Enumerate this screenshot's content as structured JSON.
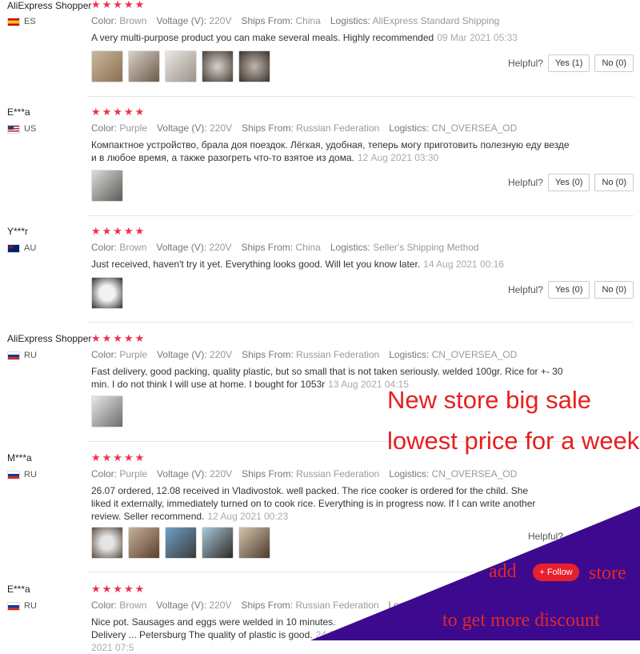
{
  "reviews": [
    {
      "user": "AliExpress Shopper",
      "country": "ES",
      "stars": "★★★★★",
      "color": "Brown",
      "voltage": "220V",
      "ships_from": "China",
      "logistics": "AliExpress Standard Shipping",
      "text": "A very multi-purpose product you can make several meals. Highly recommended",
      "date": "09 Mar 2021 05:33",
      "helpful": "Helpful?",
      "yes": "Yes (1)",
      "no": "No (0)"
    },
    {
      "user": "E***a",
      "country": "US",
      "stars": "★★★★★",
      "color": "Purple",
      "voltage": "220V",
      "ships_from": "Russian Federation",
      "logistics": "CN_OVERSEA_OD",
      "text": "Компактное устройство, брала доя поездок. Лёгкая, удобная, теперь могу приготовить полезную еду везде и в любое время, а также разогреть что-то взятое из дома.",
      "date": "12 Aug 2021 03:30",
      "helpful": "Helpful?",
      "yes": "Yes (0)",
      "no": "No (0)"
    },
    {
      "user": "Y***r",
      "country": "AU",
      "stars": "★★★★★",
      "color": "Brown",
      "voltage": "220V",
      "ships_from": "China",
      "logistics": "Seller's Shipping Method",
      "text": "Just received, haven't try it yet. Everything looks good. Will let you know later.",
      "date": "14 Aug 2021 00:16",
      "helpful": "Helpful?",
      "yes": "Yes (0)",
      "no": "No (0)"
    },
    {
      "user": "AliExpress Shopper",
      "country": "RU",
      "stars": "★★★★★",
      "color": "Purple",
      "voltage": "220V",
      "ships_from": "Russian Federation",
      "logistics": "CN_OVERSEA_OD",
      "text": "Fast delivery, good packing, quality plastic, but so small that is not taken seriously. welded 100gr. Rice for +- 30 min. I do not think I will use at home. I bought for 1053r",
      "date": "13 Aug 2021 04:15",
      "helpful": "",
      "yes": "",
      "no": ""
    },
    {
      "user": "M***a",
      "country": "RU",
      "stars": "★★★★★",
      "color": "Purple",
      "voltage": "220V",
      "ships_from": "Russian Federation",
      "logistics": "CN_OVERSEA_OD",
      "text": "26.07 ordered, 12.08 received in Vladivostok. well packed. The rice cooker is ordered for the child. She liked it externally, immediately turned on to cook rice. Everything is in progress now. If I can write another review. Seller recommend.",
      "date": "12 Aug 2021 00:23",
      "helpful": "Helpful?",
      "yes": "",
      "no": ""
    },
    {
      "user": "E***a",
      "country": "RU",
      "stars": "★★★★★",
      "color": "Brown",
      "voltage": "220V",
      "ships_from": "Russian Federation",
      "logistics": "",
      "text": "Nice pot. Sausages and eggs were welded in 10 minutes. Delivery ... Petersburg The quality of plastic is good.",
      "date": "24 Jul 2021 07:5",
      "helpful": "",
      "yes": "",
      "no": ""
    }
  ],
  "labels": {
    "color": "Color:",
    "voltage": "Voltage (V):",
    "ships_from": "Ships From:",
    "logistics": "Logistics:"
  },
  "promo": {
    "line1": "New store big sale",
    "line2": "lowest price for a week",
    "add": "add",
    "follow": "+ Follow",
    "store": "store",
    "discount": "to get more discount"
  },
  "colors": {
    "star": "#f0314a",
    "promo_red": "#e62020",
    "overlay_purple": "#3d0a8f"
  },
  "thumb_counts": [
    5,
    1,
    1,
    1,
    5,
    0
  ]
}
